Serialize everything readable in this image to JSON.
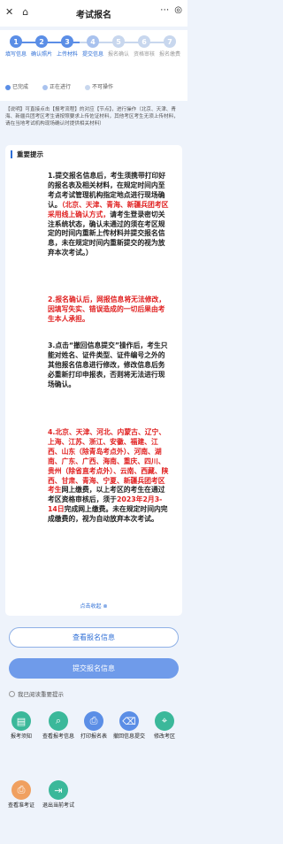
{
  "header": {
    "title": "考试报名"
  },
  "steps": [
    {
      "num": "1",
      "label": "填写信息"
    },
    {
      "num": "2",
      "label": "确认照片"
    },
    {
      "num": "3",
      "label": "上传材料"
    },
    {
      "num": "4",
      "label": "提交信息"
    },
    {
      "num": "5",
      "label": "报名确认"
    },
    {
      "num": "6",
      "label": "资格审核"
    },
    {
      "num": "7",
      "label": "报名缴费"
    }
  ],
  "legend": {
    "done": "已完成",
    "doing": "正在进行",
    "not_doable": "不可操作"
  },
  "notice": "【说明】可直接点击【报考流程】的对应【节点】，进行操作（北京、天津、青海、新疆兵团考区考生请按照要求上传佐证材料，其他考区考生无须上传材料，请在当地考试机构现场确认时提供相关材料）",
  "important": {
    "title": "重要提示",
    "p1a": "1.提交报名信息后，考生须携带打印好的报名表及相关材料，在规定时间内至考点考试管理机构指定地点进行现场确认。",
    "p1b": "（北京、天津、青海、新疆兵团考区采用线上确认方式，",
    "p1c": "请考生登录密切关注系统状态，确认未通过的须在考区规定的时间内重新上传材料并提交报名信息，未在规定时间内重新提交的视为放弃本次考试。）",
    "p2": "2.报名确认后，网报信息将无法修改，因填写失实、错误造成的一切后果由考生本人承担。",
    "p3": "3.点击“撤回信息提交”操作后，考生只能对姓名、证件类型、证件编号之外的其他报名信息进行修改，修改信息后务必重新打印申报表，否则将无法进行现场确认。",
    "p4a": "4.北京、天津、河北、内蒙古、辽宁、上海、江苏、浙江、安徽、福建、江西、山东（除青岛考点外）、河南、湖南、广东、广西、海南、重庆、四川、贵州（除省直考点外）、云南、西藏、陕西、甘肃、青海、宁夏、新疆兵团考区考生",
    "p4b": "网上缴费，以上考区的考生在通过考区资格审核后，须于",
    "p4c": "2023年2月3-14日",
    "p4d": "完成网上缴费。未在规定时间内完成缴费的，视为自动放弃本次考试。",
    "collapse": "点击收起 ⊗"
  },
  "buttons": {
    "view": "查看报名信息",
    "submit": "提交报名信息"
  },
  "agree": "我已阅读重要提示",
  "grid": [
    {
      "label": "报考须知"
    },
    {
      "label": "查看报考信息"
    },
    {
      "label": "打印报名表"
    },
    {
      "label": "撤回信息提交"
    },
    {
      "label": "修改考区"
    },
    {
      "label": "查看准考证"
    },
    {
      "label": "退出当前考试"
    }
  ],
  "colors": {
    "accent": "#2f6fd6",
    "red": "#e02020"
  }
}
